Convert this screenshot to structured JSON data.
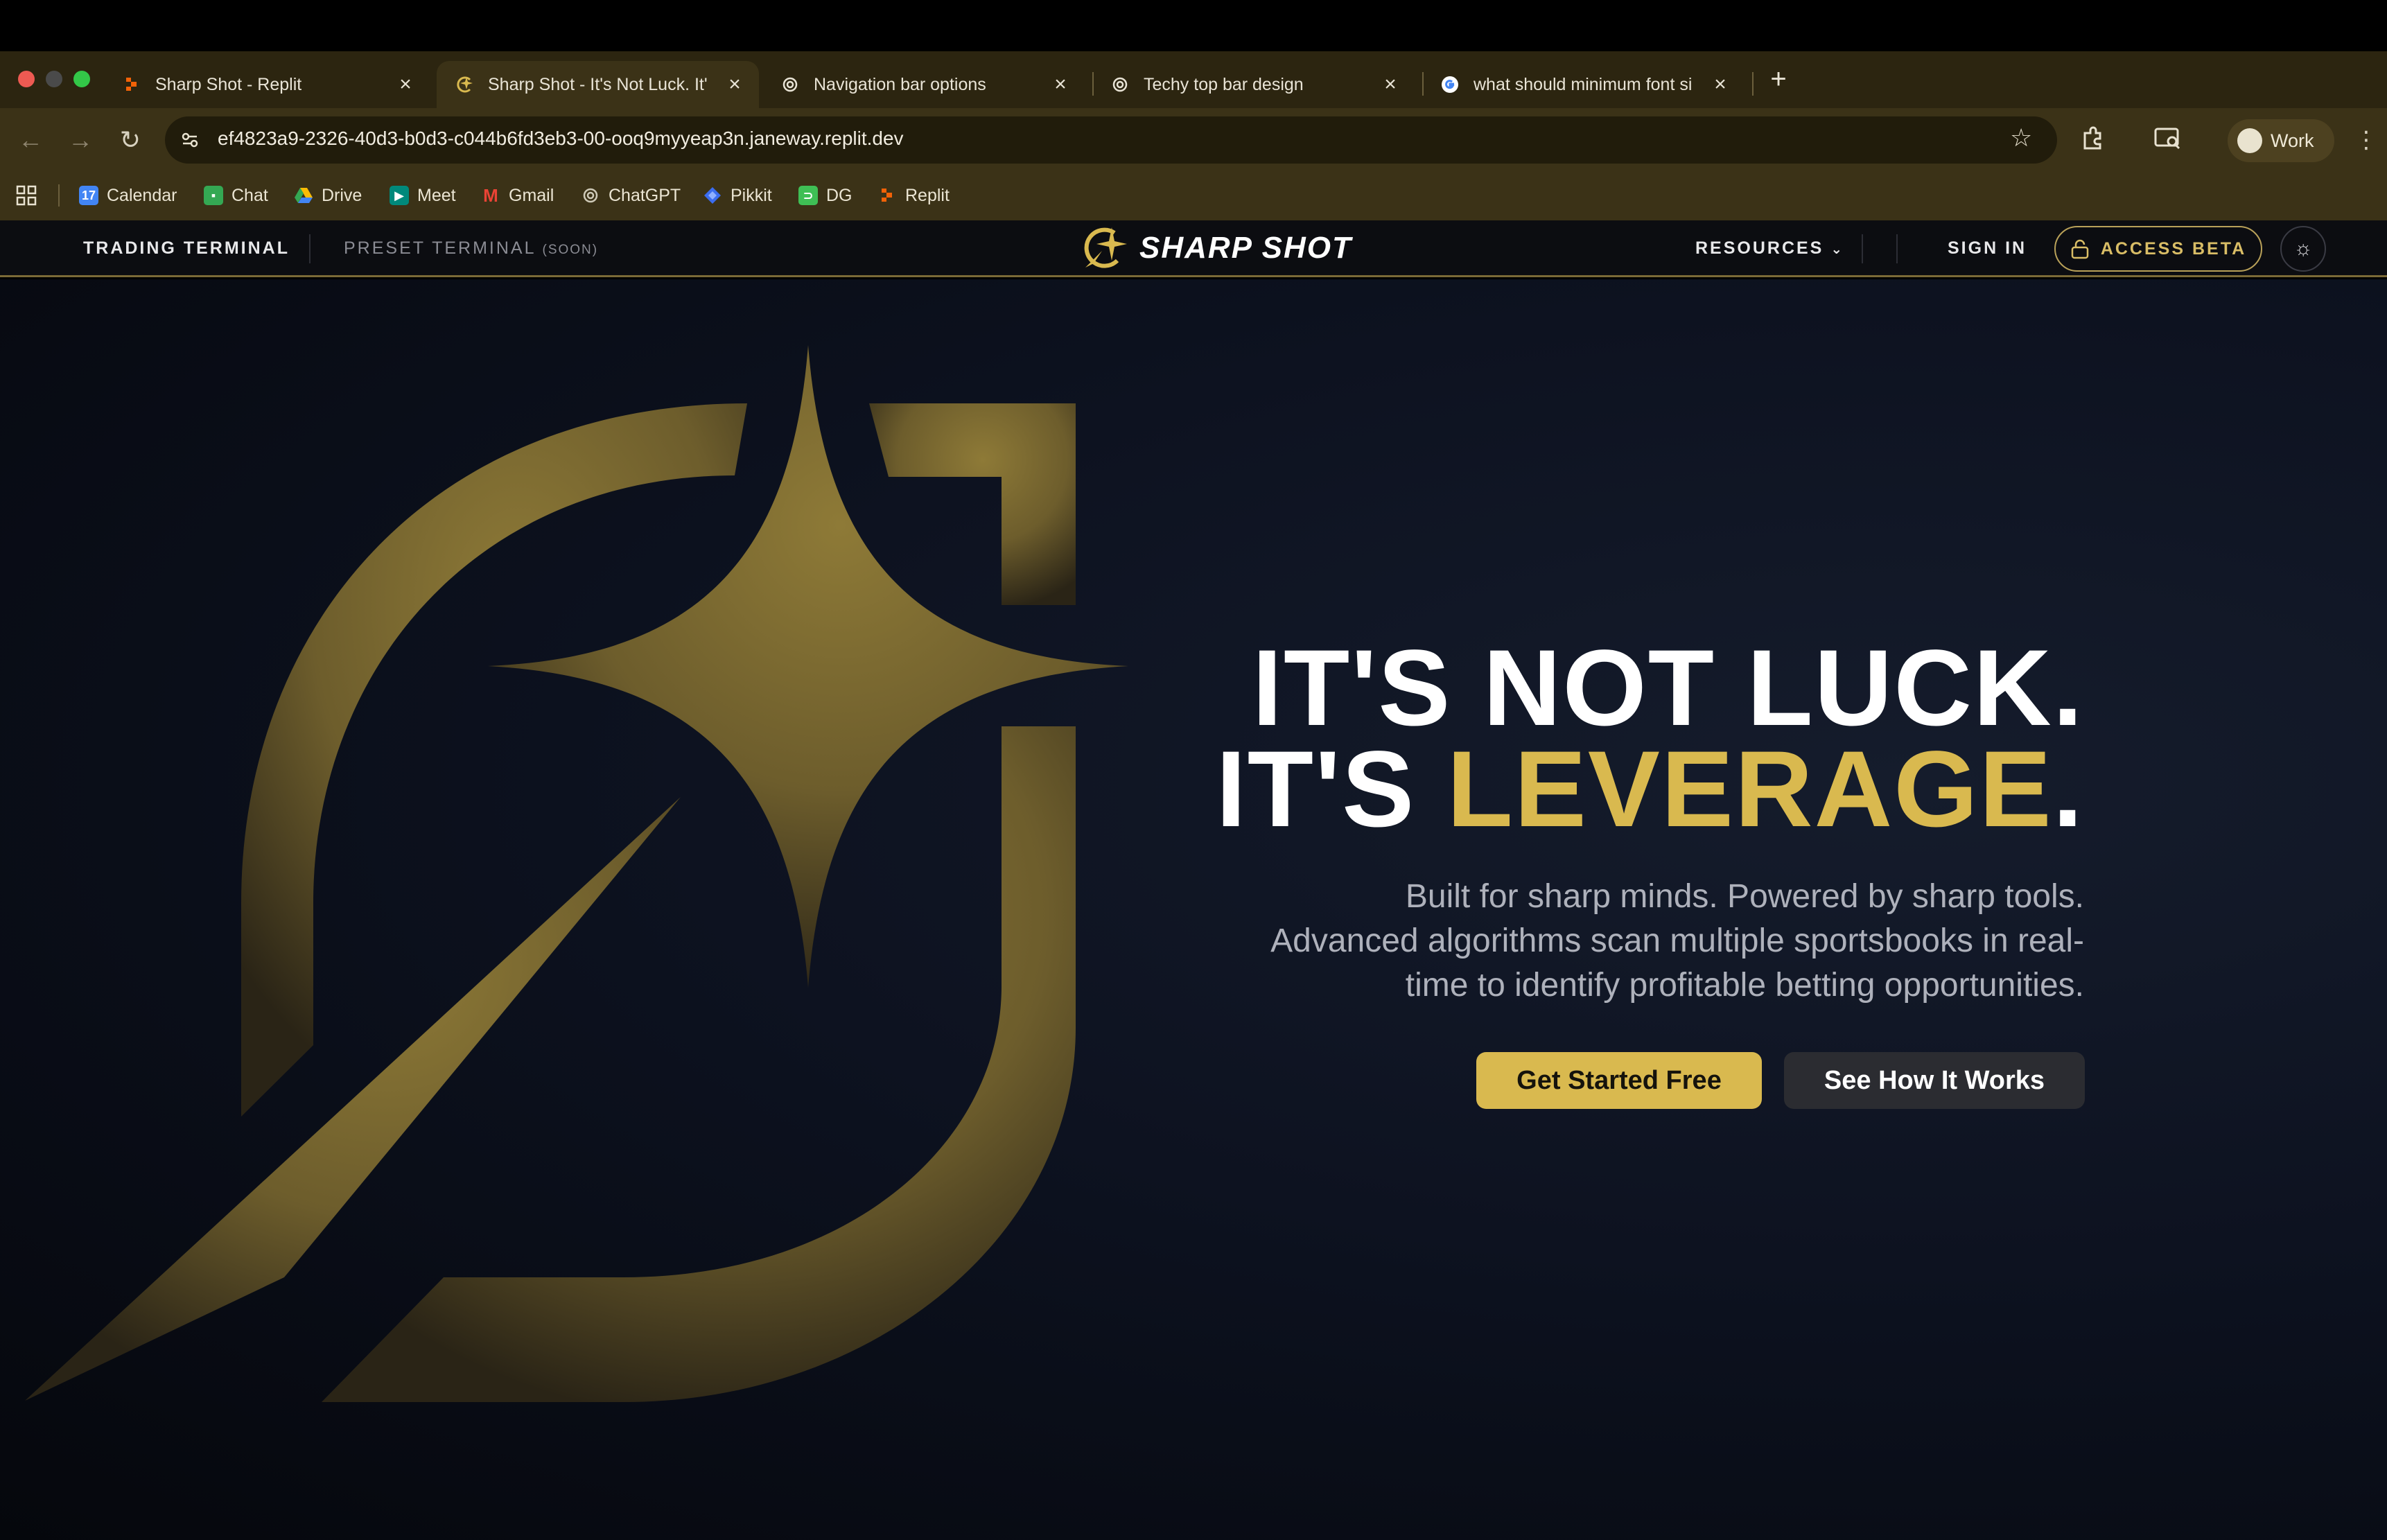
{
  "browser": {
    "tabs": [
      {
        "title": "Sharp Shot - Replit",
        "favicon": "replit-icon",
        "active": false
      },
      {
        "title": "Sharp Shot - It's Not Luck. It'",
        "favicon": "sharp-shot-icon",
        "active": true
      },
      {
        "title": "Navigation bar options",
        "favicon": "chatgpt-icon",
        "active": false
      },
      {
        "title": "Techy top bar design",
        "favicon": "chatgpt-icon",
        "active": false
      },
      {
        "title": "what should minimum font si",
        "favicon": "google-icon",
        "active": false
      }
    ],
    "url": "ef4823a9-2326-40d3-b0d3-c044b6fd3eb3-00-ooq9myyeap3n.janeway.replit.dev",
    "profile_label": "Work",
    "bookmarks": [
      {
        "label": "Calendar",
        "icon": "calendar-icon",
        "color": "#4285f4"
      },
      {
        "label": "Chat",
        "icon": "chat-icon",
        "color": "#34a853"
      },
      {
        "label": "Drive",
        "icon": "drive-icon",
        "color": "#fbbc04"
      },
      {
        "label": "Meet",
        "icon": "meet-icon",
        "color": "#00897b"
      },
      {
        "label": "Gmail",
        "icon": "gmail-icon",
        "color": "#ea4335"
      },
      {
        "label": "ChatGPT",
        "icon": "chatgpt-icon",
        "color": "#cfcab8"
      },
      {
        "label": "Pikkit",
        "icon": "pikkit-icon",
        "color": "#3b6df0"
      },
      {
        "label": "DG",
        "icon": "dg-icon",
        "color": "#3fbf55"
      },
      {
        "label": "Replit",
        "icon": "replit-icon",
        "color": "#f26207"
      }
    ]
  },
  "site_nav": {
    "trading_terminal": "TRADING TERMINAL",
    "preset_terminal": "PRESET TERMINAL",
    "preset_soon": "(SOON)",
    "brand": "SHARP SHOT",
    "resources": "RESOURCES",
    "sign_in": "SIGN IN",
    "access_beta": "ACCESS BETA"
  },
  "hero": {
    "headline_line1": "IT'S NOT LUCK.",
    "headline_line2_prefix": "IT'S ",
    "headline_line2_highlight": "LEVERAGE",
    "headline_line2_suffix": ".",
    "subtext_line1": "Built for sharp minds. Powered by sharp tools.",
    "subtext_line2": "Advanced algorithms scan multiple sportsbooks in real-",
    "subtext_line3": "time to identify profitable betting opportunities.",
    "primary_cta": "Get Started Free",
    "secondary_cta": "See How It Works"
  },
  "colors": {
    "accent_gold": "#d9b94f",
    "background": "#0d1220",
    "tab_bar": "#2c2510"
  }
}
